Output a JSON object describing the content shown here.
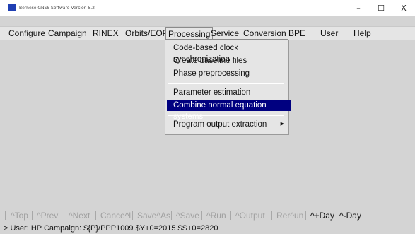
{
  "window": {
    "title": "Bernese GNSS Software Version 5.2",
    "minimize": "–",
    "maximize": "☐",
    "close": "X"
  },
  "menubar": {
    "items": [
      "Configure",
      "Campaign",
      "RINEX",
      "Orbits/EOP",
      "Processing",
      "Service",
      "Conversion",
      "BPE",
      "User",
      "Help"
    ],
    "active": "Processing"
  },
  "processing_menu": {
    "items": [
      "Code-based clock synchronization",
      "Create baseline files",
      "Phase preprocessing",
      "Parameter estimation",
      "Combine normal equation systems",
      "Program output extraction"
    ],
    "selected": "Combine normal equation systems",
    "submenu_arrow": "▶"
  },
  "toolbar": {
    "items": [
      "^Top",
      "^Prev",
      "^Next",
      "Cance^l",
      "Save^As",
      "^Save",
      "^Run",
      "^Output",
      "Rer^un",
      "^+Day",
      "^-Day"
    ],
    "enabled": [
      "^+Day",
      "^-Day"
    ]
  },
  "status": {
    "text": "> User: HP  Campaign: ${P}/PPP1009  $Y+0=2015  $S+0=2820"
  },
  "colors": {
    "selection": "#000080",
    "app_icon": "#1f3fb3",
    "background": "#d4d4d4"
  }
}
